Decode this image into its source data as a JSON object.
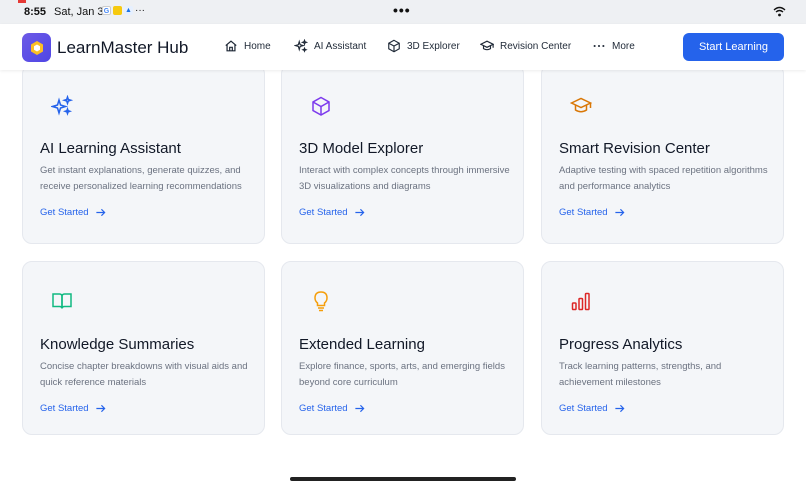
{
  "status_bar": {
    "time": "8:55",
    "date": "Sat, Jan 3",
    "app_icons": [
      "google-icon",
      "note-icon",
      "sync-icon",
      "more-dots-icon"
    ],
    "center_dots": "•••"
  },
  "navbar": {
    "brand": "LearnMaster Hub",
    "items": [
      {
        "label": "Home",
        "icon": "home-icon"
      },
      {
        "label": "AI Assistant",
        "icon": "sparkles-icon"
      },
      {
        "label": "3D Explorer",
        "icon": "cube-icon"
      },
      {
        "label": "Revision Center",
        "icon": "graduation-cap-icon"
      },
      {
        "label": "More",
        "icon": "ellipsis-icon"
      }
    ],
    "cta": "Start Learning",
    "colors": {
      "cta": "#2563eb",
      "logo": "#5b4fe6"
    }
  },
  "cards": [
    {
      "title": "AI Learning Assistant",
      "description": "Get instant explanations, generate quizzes, and receive personalized learning recommendations",
      "link": "Get Started",
      "icon": "sparkles-icon",
      "icon_color": "#2563eb"
    },
    {
      "title": "3D Model Explorer",
      "description": "Interact with complex concepts through immersive 3D visualizations and diagrams",
      "link": "Get Started",
      "icon": "cube-icon",
      "icon_color": "#7c3aed"
    },
    {
      "title": "Smart Revision Center",
      "description": "Adaptive testing with spaced repetition algorithms and performance analytics",
      "link": "Get Started",
      "icon": "graduation-cap-icon",
      "icon_color": "#d97706"
    },
    {
      "title": "Knowledge Summaries",
      "description": "Concise chapter breakdowns with visual aids and quick reference materials",
      "link": "Get Started",
      "icon": "open-book-icon",
      "icon_color": "#10b981"
    },
    {
      "title": "Extended Learning",
      "description": "Explore finance, sports, arts, and emerging fields beyond core curriculum",
      "link": "Get Started",
      "icon": "lightbulb-icon",
      "icon_color": "#f59e0b"
    },
    {
      "title": "Progress Analytics",
      "description": "Track learning patterns, strengths, and achievement milestones",
      "link": "Get Started",
      "icon": "bar-chart-icon",
      "icon_color": "#dc2626"
    }
  ]
}
